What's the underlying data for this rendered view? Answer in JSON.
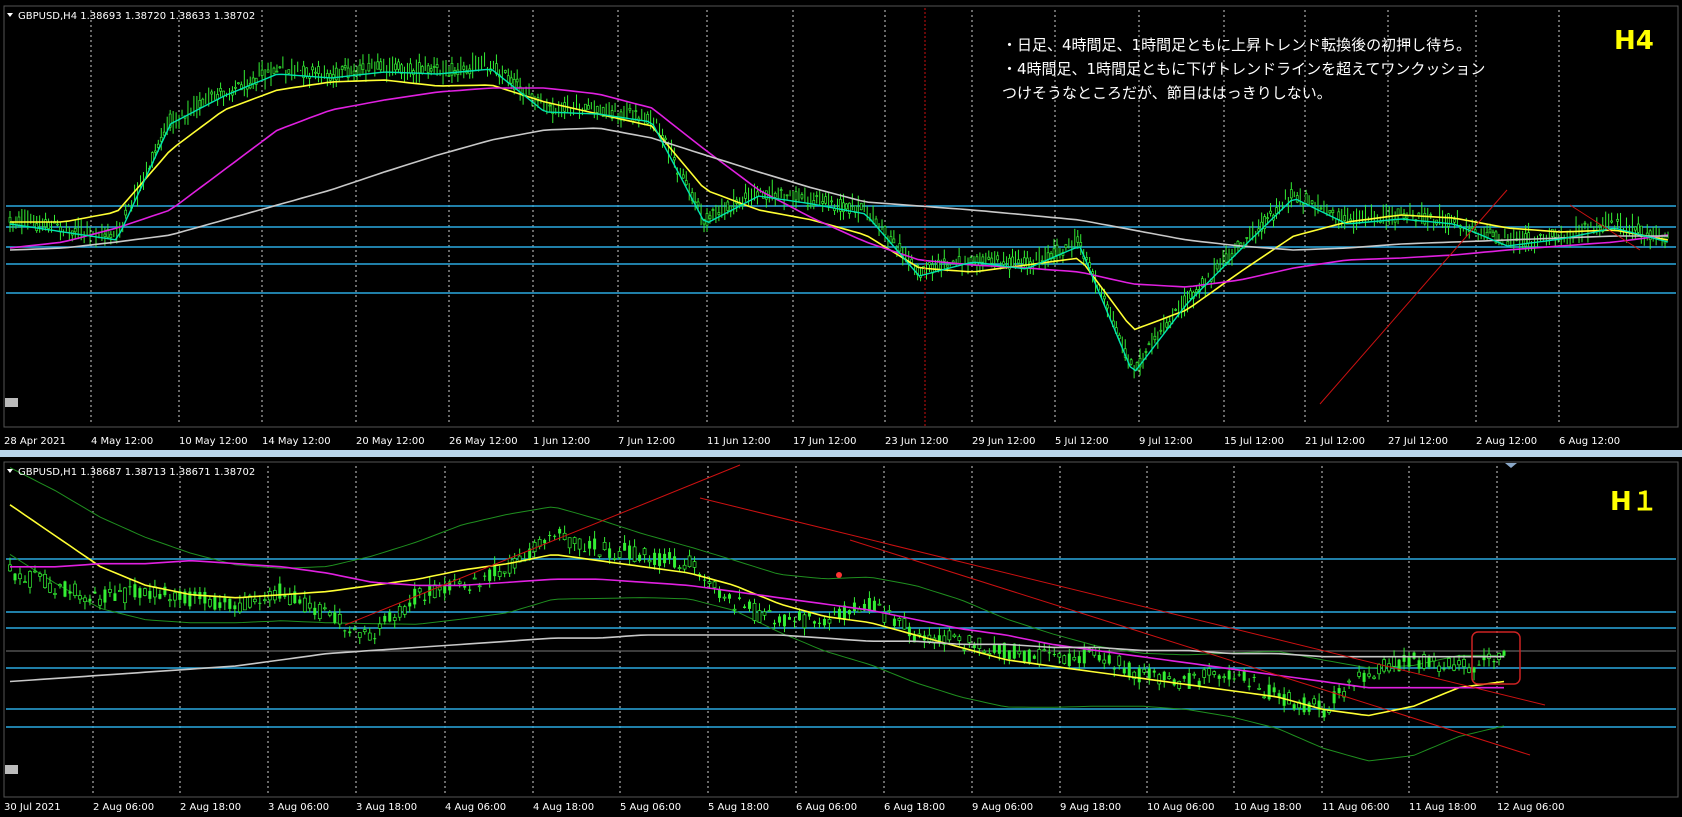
{
  "colors": {
    "background": "#000000",
    "separator": "#b8d4e8",
    "level_line": "#2aa9e0",
    "candle": "#33ee33",
    "ma_fast": "#00e5b0",
    "ma_yellow": "#ffff33",
    "ma_magenta": "#e020e0",
    "ma_gray": "#c8c8c8",
    "trendline": "#cc1111",
    "bollinger": "#1f8f1f",
    "highlight_box": "#cc2222",
    "axis_text": "#ffffff",
    "label": "#ffff00"
  },
  "panels": [
    {
      "id": "h4",
      "header": "GBPUSD,H4  1.38693 1.38720 1.38633 1.38702",
      "label": "H4",
      "x_ticks": [
        "28 Apr 2021",
        "4 May 12:00",
        "10 May 12:00",
        "14 May 12:00",
        "20 May 12:00",
        "26 May 12:00",
        "1 Jun 12:00",
        "7 Jun 12:00",
        "11 Jun 12:00",
        "17 Jun 12:00",
        "23 Jun 12:00",
        "29 Jun 12:00",
        "5 Jul 12:00",
        "9 Jul 12:00",
        "15 Jul 12:00",
        "21 Jul 12:00",
        "27 Jul 12:00",
        "2 Aug 12:00",
        "6 Aug 12:00"
      ],
      "annotations": [
        "・日足、4時間足、1時間足ともに上昇トレンド転換後の初押し待ち。",
        "・4時間足、1時間足ともに下げトレンドラインを超えてワンクッション",
        "つけそうなところだが、節目ははっきりしない。"
      ]
    },
    {
      "id": "h1",
      "header": "GBPUSD,H1  1.38687 1.38713 1.38671 1.38702",
      "label": "H１",
      "x_ticks": [
        "30 Jul 2021",
        "2 Aug 06:00",
        "2 Aug 18:00",
        "3 Aug 06:00",
        "3 Aug 18:00",
        "4 Aug 06:00",
        "4 Aug 18:00",
        "5 Aug 06:00",
        "5 Aug 18:00",
        "6 Aug 06:00",
        "6 Aug 18:00",
        "9 Aug 06:00",
        "9 Aug 18:00",
        "10 Aug 06:00",
        "10 Aug 18:00",
        "11 Aug 06:00",
        "11 Aug 18:00",
        "12 Aug 06:00"
      ]
    }
  ],
  "chart_data": [
    {
      "type": "line",
      "title": "GBPUSD,H4  1.38693 1.38720 1.38633 1.38702",
      "instrument": "GBPUSD",
      "timeframe": "H4",
      "ohlc_last": {
        "open": 1.38693,
        "high": 1.3872,
        "low": 1.38633,
        "close": 1.38702
      },
      "grid": true,
      "y_axis": "hidden",
      "categories": [
        "28 Apr 2021",
        "4 May 12:00",
        "10 May 12:00",
        "14 May 12:00",
        "20 May 12:00",
        "26 May 12:00",
        "1 Jun 12:00",
        "7 Jun 12:00",
        "11 Jun 12:00",
        "17 Jun 12:00",
        "23 Jun 12:00",
        "29 Jun 12:00",
        "5 Jul 12:00",
        "9 Jul 12:00",
        "15 Jul 12:00",
        "21 Jul 12:00",
        "27 Jul 12:00",
        "2 Aug 12:00",
        "6 Aug 12:00"
      ],
      "series": [
        {
          "role": "price",
          "values": [
            210,
            218,
            226,
            110,
            82,
            60,
            64,
            58,
            60,
            55,
            98,
            100,
            108,
            210,
            182,
            190,
            200,
            262,
            248,
            255,
            232,
            360,
            290,
            236,
            184,
            210,
            205,
            210,
            232,
            225,
            214,
            228
          ]
        },
        {
          "role": "ma-yellow",
          "values": [
            212,
            212,
            202,
            140,
            100,
            80,
            72,
            70,
            76,
            75,
            92,
            104,
            116,
            180,
            200,
            210,
            225,
            258,
            262,
            255,
            248,
            320,
            300,
            262,
            226,
            212,
            205,
            208,
            218,
            222,
            220,
            230
          ]
        },
        {
          "role": "ma-magenta",
          "values": [
            238,
            232,
            218,
            200,
            160,
            120,
            100,
            90,
            82,
            78,
            78,
            84,
            98,
            140,
            180,
            208,
            232,
            250,
            255,
            258,
            262,
            274,
            277,
            270,
            258,
            250,
            248,
            245,
            240,
            236,
            232,
            225
          ]
        },
        {
          "role": "ma-gray",
          "values": [
            240,
            238,
            232,
            225,
            210,
            195,
            180,
            162,
            145,
            130,
            120,
            118,
            128,
            145,
            162,
            178,
            192,
            196,
            200,
            205,
            210,
            220,
            230,
            236,
            240,
            238,
            234,
            232,
            230,
            228,
            226,
            226
          ]
        }
      ],
      "levels": [
        "level-1",
        "level-2",
        "level-3",
        "level-4",
        "level-5"
      ]
    },
    {
      "type": "line",
      "title": "GBPUSD,H1  1.38687 1.38713 1.38671 1.38702",
      "instrument": "GBPUSD",
      "timeframe": "H1",
      "ohlc_last": {
        "open": 1.38687,
        "high": 1.38713,
        "low": 1.38671,
        "close": 1.38702
      },
      "grid": true,
      "y_axis": "hidden",
      "categories": [
        "30 Jul 2021",
        "2 Aug 06:00",
        "2 Aug 18:00",
        "3 Aug 06:00",
        "3 Aug 18:00",
        "4 Aug 06:00",
        "4 Aug 18:00",
        "5 Aug 06:00",
        "5 Aug 18:00",
        "6 Aug 06:00",
        "6 Aug 18:00",
        "9 Aug 06:00",
        "9 Aug 18:00",
        "10 Aug 06:00",
        "10 Aug 18:00",
        "11 Aug 06:00",
        "11 Aug 18:00",
        "12 Aug 06:00"
      ],
      "series": [
        {
          "role": "price",
          "values": [
            0.7,
            0.66,
            0.62,
            0.64,
            0.62,
            0.6,
            0.64,
            0.56,
            0.5,
            0.63,
            0.66,
            0.72,
            0.82,
            0.78,
            0.76,
            0.73,
            0.6,
            0.54,
            0.56,
            0.6,
            0.5,
            0.48,
            0.45,
            0.42,
            0.44,
            0.37,
            0.35,
            0.38,
            0.3,
            0.26,
            0.38,
            0.42,
            0.4,
            0.42
          ]
        },
        {
          "role": "ma-yellow",
          "values": [
            0.92,
            0.82,
            0.72,
            0.66,
            0.63,
            0.62,
            0.63,
            0.64,
            0.66,
            0.68,
            0.71,
            0.73,
            0.76,
            0.74,
            0.72,
            0.7,
            0.66,
            0.6,
            0.56,
            0.54,
            0.5,
            0.46,
            0.42,
            0.4,
            0.38,
            0.36,
            0.34,
            0.32,
            0.3,
            0.26,
            0.24,
            0.27,
            0.33,
            0.35
          ]
        },
        {
          "role": "ma-magenta",
          "values": [
            0.72,
            0.72,
            0.73,
            0.73,
            0.74,
            0.73,
            0.72,
            0.7,
            0.67,
            0.66,
            0.66,
            0.67,
            0.68,
            0.68,
            0.67,
            0.66,
            0.64,
            0.62,
            0.6,
            0.58,
            0.55,
            0.52,
            0.5,
            0.47,
            0.45,
            0.43,
            0.41,
            0.39,
            0.37,
            0.35,
            0.33,
            0.33,
            0.33,
            0.33
          ]
        },
        {
          "role": "ma-gray",
          "values": [
            0.35,
            0.36,
            0.37,
            0.38,
            0.39,
            0.4,
            0.42,
            0.44,
            0.45,
            0.46,
            0.47,
            0.48,
            0.49,
            0.49,
            0.5,
            0.5,
            0.5,
            0.5,
            0.49,
            0.48,
            0.48,
            0.47,
            0.47,
            0.46,
            0.46,
            0.45,
            0.45,
            0.44,
            0.44,
            0.43,
            0.43,
            0.43,
            0.43,
            0.43
          ]
        }
      ],
      "levels": [
        "level-1",
        "level-2",
        "level-3",
        "level-4",
        "level-5",
        "level-6"
      ]
    }
  ]
}
